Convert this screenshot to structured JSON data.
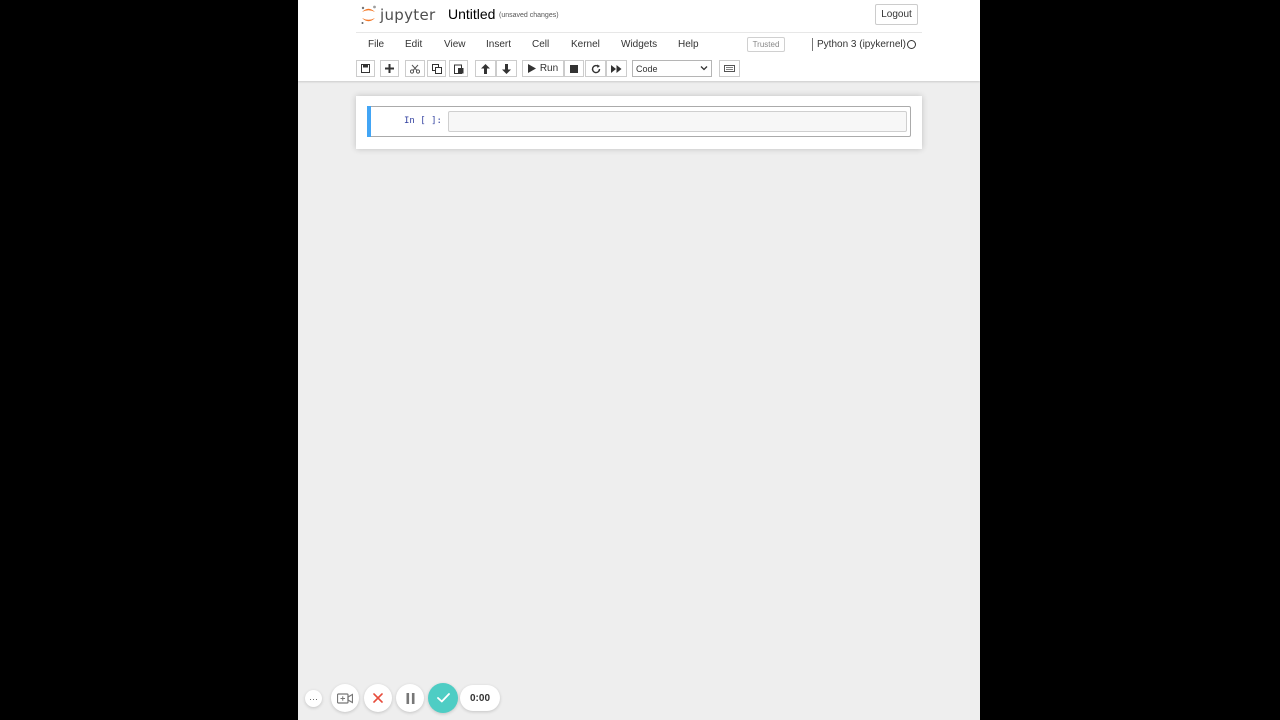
{
  "header": {
    "logo_text": "jupyter",
    "notebook_name": "Untitled",
    "save_status": "(unsaved changes)",
    "logout_label": "Logout"
  },
  "menubar": {
    "items": [
      "File",
      "Edit",
      "View",
      "Insert",
      "Cell",
      "Kernel",
      "Widgets",
      "Help"
    ],
    "trusted_label": "Trusted",
    "kernel_name": "Python 3 (ipykernel)",
    "kernel_status": "idle"
  },
  "toolbar": {
    "buttons": [
      "save-icon",
      "plus-icon",
      "scissors-icon",
      "copy-icon",
      "paste-icon",
      "arrow-up-icon",
      "arrow-down-icon",
      "play-icon",
      "stop-icon",
      "restart-icon",
      "fast-forward-icon",
      "keyboard-icon"
    ],
    "run_label": "Run",
    "cell_type": "Code"
  },
  "cells": [
    {
      "prompt": "In [ ]:",
      "source": ""
    }
  ],
  "recorder": {
    "timer": "0:00"
  },
  "colors": {
    "cell_accent": "#42a5f5",
    "logo_orange": "#f37726",
    "confirm_green": "#4ecdc4",
    "cancel_red": "#e74c3c"
  }
}
